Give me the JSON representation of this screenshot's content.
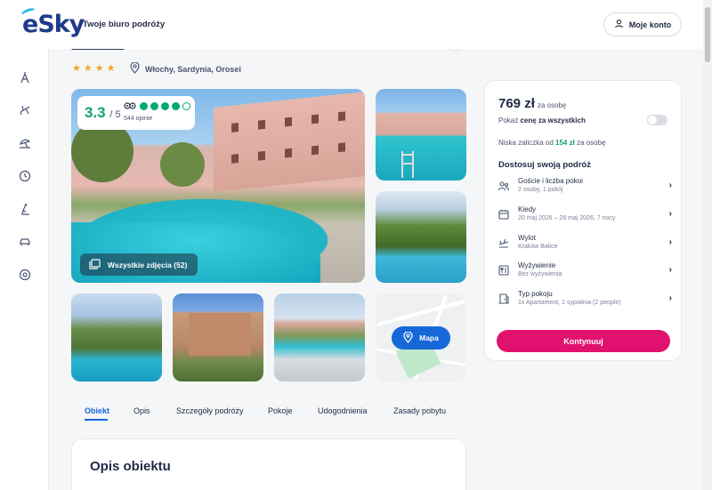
{
  "header": {
    "logo_text": "eSky",
    "tagline": "Twoje biuro podróży",
    "account_label": "Moje konto"
  },
  "sidebar": {
    "icons": [
      "attractions-icon",
      "flight-icon",
      "beach-icon",
      "last-minute-icon",
      "ski-icon",
      "car-icon",
      "cruise-icon"
    ]
  },
  "hotel": {
    "stars": "★★★★",
    "location": "Włochy, Sardynia, Orosei"
  },
  "gallery": {
    "rating_score": "3.3",
    "rating_scale": "/ 5",
    "tripadvisor_dots": [
      1,
      1,
      1,
      1,
      0
    ],
    "opinions": "544 opinie",
    "all_photos_label": "Wszystkie zdjęcia (52)",
    "map_label": "Mapa"
  },
  "tabs": [
    {
      "label": "Obiekt",
      "active": true
    },
    {
      "label": "Opis"
    },
    {
      "label": "Szczegóły podróży"
    },
    {
      "label": "Pokoje"
    },
    {
      "label": "Udogodnienia"
    },
    {
      "label": "Zasady pobytu"
    }
  ],
  "description": {
    "title": "Opis obiektu"
  },
  "booking": {
    "price": "769 zł",
    "price_unit": "za osobę",
    "show_total_prefix": "Pokaż ",
    "show_total_bold": "cenę za wszystkich",
    "deposit_prefix": "Niska zaliczka od ",
    "deposit_amount": "154 zł",
    "deposit_suffix": " za osobę",
    "customize_title": "Dostosuj swoją podróż",
    "options": [
      {
        "label": "Goście i liczba pokoi",
        "value": "2 osoby, 1 pokój",
        "icon": "guests-icon"
      },
      {
        "label": "Kiedy",
        "value": "20 maj 2026 – 28 maj 2026, 7 nocy",
        "icon": "calendar-icon"
      },
      {
        "label": "Wylot",
        "value": "Kraków Balice",
        "icon": "departure-icon"
      },
      {
        "label": "Wyżywienie",
        "value": "Bez wyżywienia",
        "icon": "meal-icon"
      },
      {
        "label": "Typ pokoju",
        "value": "1x Apartament, 1 sypialnia (2 people)",
        "icon": "room-icon"
      }
    ],
    "cta_label": "Kontynuuj"
  },
  "colors": {
    "brand_blue": "#1e3b8a",
    "accent_blue": "#1668d8",
    "cta_pink": "#e1126f",
    "rating_green": "#12a36a"
  }
}
